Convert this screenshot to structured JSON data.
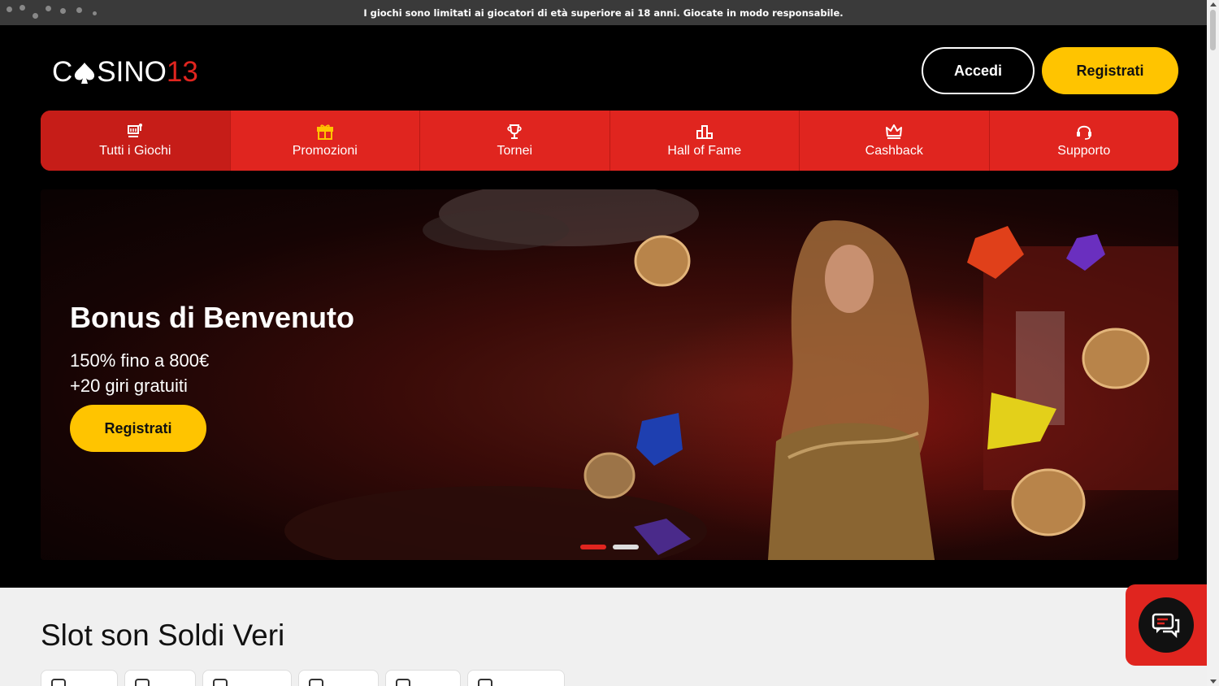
{
  "notice": {
    "text": "I giochi sono limitati ai giocatori di età superiore ai 18 anni. Giocate in modo responsabile."
  },
  "brand": {
    "logo_prefix": "C",
    "logo_mid": "SINO",
    "logo_num": "13",
    "accent": "#e0251f",
    "yellow": "#ffc400"
  },
  "header": {
    "login_label": "Accedi",
    "register_label": "Registrati"
  },
  "nav": {
    "items": [
      {
        "label": "Tutti i Giochi",
        "icon": "games-icon"
      },
      {
        "label": "Promozioni",
        "icon": "gift-icon"
      },
      {
        "label": "Tornei",
        "icon": "trophy-icon"
      },
      {
        "label": "Hall of Fame",
        "icon": "podium-icon"
      },
      {
        "label": "Cashback",
        "icon": "crown-icon"
      },
      {
        "label": "Supporto",
        "icon": "headset-icon"
      }
    ]
  },
  "hero": {
    "title": "Bonus di Benvenuto",
    "line1": "150% fino a 800€",
    "line2": "+20 giri gratuiti",
    "cta": "Registrati",
    "slides": 2,
    "active_slide": 1
  },
  "section": {
    "title": "Slot son Soldi Veri"
  }
}
